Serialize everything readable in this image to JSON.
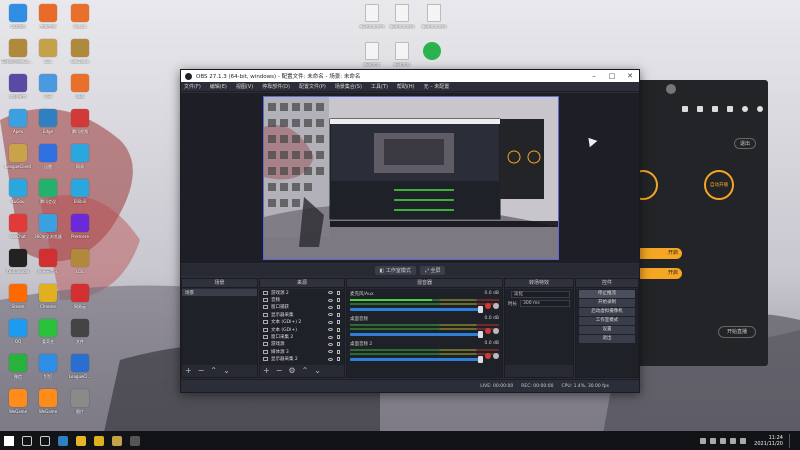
{
  "desktop": {
    "icons_col1": [
      {
        "label": "QQ游戏",
        "color": "#2f8de4"
      },
      {
        "label": "英雄联盟WeGame",
        "color": "#b08a3a"
      },
      {
        "label": "腾讯课堂",
        "color": "#5a4aa3"
      },
      {
        "label": "Apex",
        "color": "#3aa0e0"
      },
      {
        "label": "LeagueClient",
        "color": "#c9a24a"
      },
      {
        "label": "KuGou",
        "color": "#2aa7de"
      },
      {
        "label": "WeChat",
        "color": "#e03a3a"
      },
      {
        "label": "OBS Studio",
        "color": "#222222"
      },
      {
        "label": "Steam",
        "color": "#ff6a00"
      },
      {
        "label": "QQ",
        "color": "#1d9bf0"
      },
      {
        "label": "微信",
        "color": "#28b13d"
      },
      {
        "label": "WeGame",
        "color": "#ff8c1a"
      }
    ],
    "icons_col2": [
      {
        "label": "完美世界",
        "color": "#e86b2a"
      },
      {
        "label": "LOL",
        "color": "#c4a24a"
      },
      {
        "label": "TGP",
        "color": "#4a9adf"
      },
      {
        "label": "Edge",
        "color": "#2f80c0"
      },
      {
        "label": "迅雷",
        "color": "#2f6fe0"
      },
      {
        "label": "腾讯会议",
        "color": "#23b26d"
      },
      {
        "label": "360安全浏览器",
        "color": "#3aa0e0"
      },
      {
        "label": "网易云音乐",
        "color": "#d23030"
      },
      {
        "label": "Chrome",
        "color": "#e0b020"
      },
      {
        "label": "爱奇艺",
        "color": "#28c23d"
      },
      {
        "label": "钉钉",
        "color": "#2f8de4"
      },
      {
        "label": "WeGame",
        "color": "#ff8c1a"
      }
    ],
    "icons_col3": [
      {
        "label": "Steam",
        "color": "#e8702a"
      },
      {
        "label": "WeGame",
        "color": "#b08a3a"
      },
      {
        "label": "OBS",
        "color": "#e8702a"
      },
      {
        "label": "腾讯视频",
        "color": "#d23a3a"
      },
      {
        "label": "网易",
        "color": "#2aa7de"
      },
      {
        "label": "Bilibili",
        "color": "#2aa7de"
      },
      {
        "label": "Premiere",
        "color": "#6a2ad9"
      },
      {
        "label": "LOL",
        "color": "#b08a3a"
      },
      {
        "label": "网易云",
        "color": "#d23030"
      },
      {
        "label": "文件",
        "color": "#444444"
      },
      {
        "label": "LeagueCl...",
        "color": "#2a6fd0"
      },
      {
        "label": "图片",
        "color": "#8a8a8a"
      }
    ],
    "top_docs": [
      {
        "label": "新建文本文档"
      },
      {
        "label": "新建文本文档"
      },
      {
        "label": "新建文本文档"
      },
      {
        "label": "新建文本"
      },
      {
        "label": "新建文本"
      }
    ]
  },
  "obs": {
    "title": "OBS 27.1.3 (64-bit, windows) - 配置文件: 未命名 - 场景: 未命名",
    "window_controls": [
      "–",
      "□",
      "✕"
    ],
    "menu": [
      "文件(F)",
      "编辑(E)",
      "视图(V)",
      "停靠部件(D)",
      "配置文件(P)",
      "场景集合(S)",
      "工具(T)",
      "帮助(H)",
      "无 – 未配置"
    ],
    "preview_controls": [
      "◧ 工作室模式",
      "⤢ 全屏"
    ],
    "docks": {
      "scenes": {
        "title": "场景",
        "items": [
          "场景"
        ]
      },
      "sources": {
        "title": "来源",
        "items": [
          "游戏源 2",
          "音频",
          "窗口捕获",
          "显示器采集",
          "文本 (GDI+) 2",
          "文本 (GDI+)",
          "窗口采集 2",
          "游戏源",
          "媒体源 3",
          "显示器采集 2"
        ]
      },
      "mixer": {
        "title": "混音器",
        "tracks": [
          {
            "name": "麦克风/Aux",
            "db": "0.0 dB"
          },
          {
            "name": "桌面音频",
            "db": "0.0 dB"
          },
          {
            "name": "桌面音频 2",
            "db": "0.0 dB"
          }
        ]
      },
      "transitions": {
        "title": "转场特效",
        "type": "淡化",
        "duration_label": "时长",
        "duration": "300 ms"
      },
      "controls": {
        "title": "控件",
        "buttons": [
          "停止推流",
          "开始录制",
          "启动虚拟摄像机",
          "工作室模式",
          "设置",
          "退出"
        ]
      }
    },
    "status": {
      "live": "LIVE: 00:00:00",
      "rec": "REC: 00:00:00",
      "cpu": "CPU: 1.4%, 30.00 fps"
    }
  },
  "bg_app": {
    "buttons": [
      "退出",
      "开启",
      "开启"
    ],
    "mode_label": "自动开播",
    "bottom_label": "开始直播"
  },
  "taskbar": {
    "items": [
      {
        "name": "start",
        "color": "#ffffff"
      },
      {
        "name": "search",
        "color": "#cccccc"
      },
      {
        "name": "task-view",
        "color": "#cccccc"
      },
      {
        "name": "edge",
        "color": "#2f80c0"
      },
      {
        "name": "file-explorer",
        "color": "#e7b52c"
      },
      {
        "name": "chrome",
        "color": "#e0b020"
      },
      {
        "name": "lol",
        "color": "#c4a24a"
      },
      {
        "name": "obs",
        "color": "#555555"
      }
    ],
    "time": "11:24",
    "date": "2021/11/20"
  }
}
